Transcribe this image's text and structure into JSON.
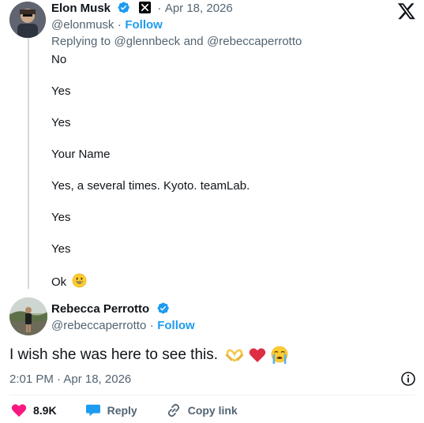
{
  "original_tweet": {
    "author_name": "Elon Musk",
    "handle": "@elonmusk",
    "follow_label": "Follow",
    "date": "Apr 18, 2026",
    "separator": "·",
    "replying_prefix": "Replying to",
    "replying_to_1": "@glennbeck",
    "replying_and": "and",
    "replying_to_2": "@rebeccaperrotto",
    "lines": [
      "No",
      "Yes",
      "Yes",
      "Your Name",
      "Yes, a several times. Kyoto. teamLab.",
      "Yes",
      "Yes",
      "Ok"
    ],
    "last_line_emoji": "grinning-face"
  },
  "reply_tweet": {
    "author_name": "Rebecca Perrotto",
    "handle": "@rebeccaperrotto",
    "follow_label": "Follow",
    "separator": "·",
    "text": "I wish she was here to see this.",
    "emojis": [
      "heart-hands",
      "red-heart",
      "loudly-crying-face"
    ],
    "timestamp": "2:01 PM · Apr 18, 2026"
  },
  "actions": {
    "like_count": "8.9K",
    "reply_label": "Reply",
    "copy_label": "Copy link"
  },
  "colors": {
    "accent": "#1d9bf0",
    "like": "#f91880",
    "muted": "#536471",
    "text": "#0f1419"
  }
}
